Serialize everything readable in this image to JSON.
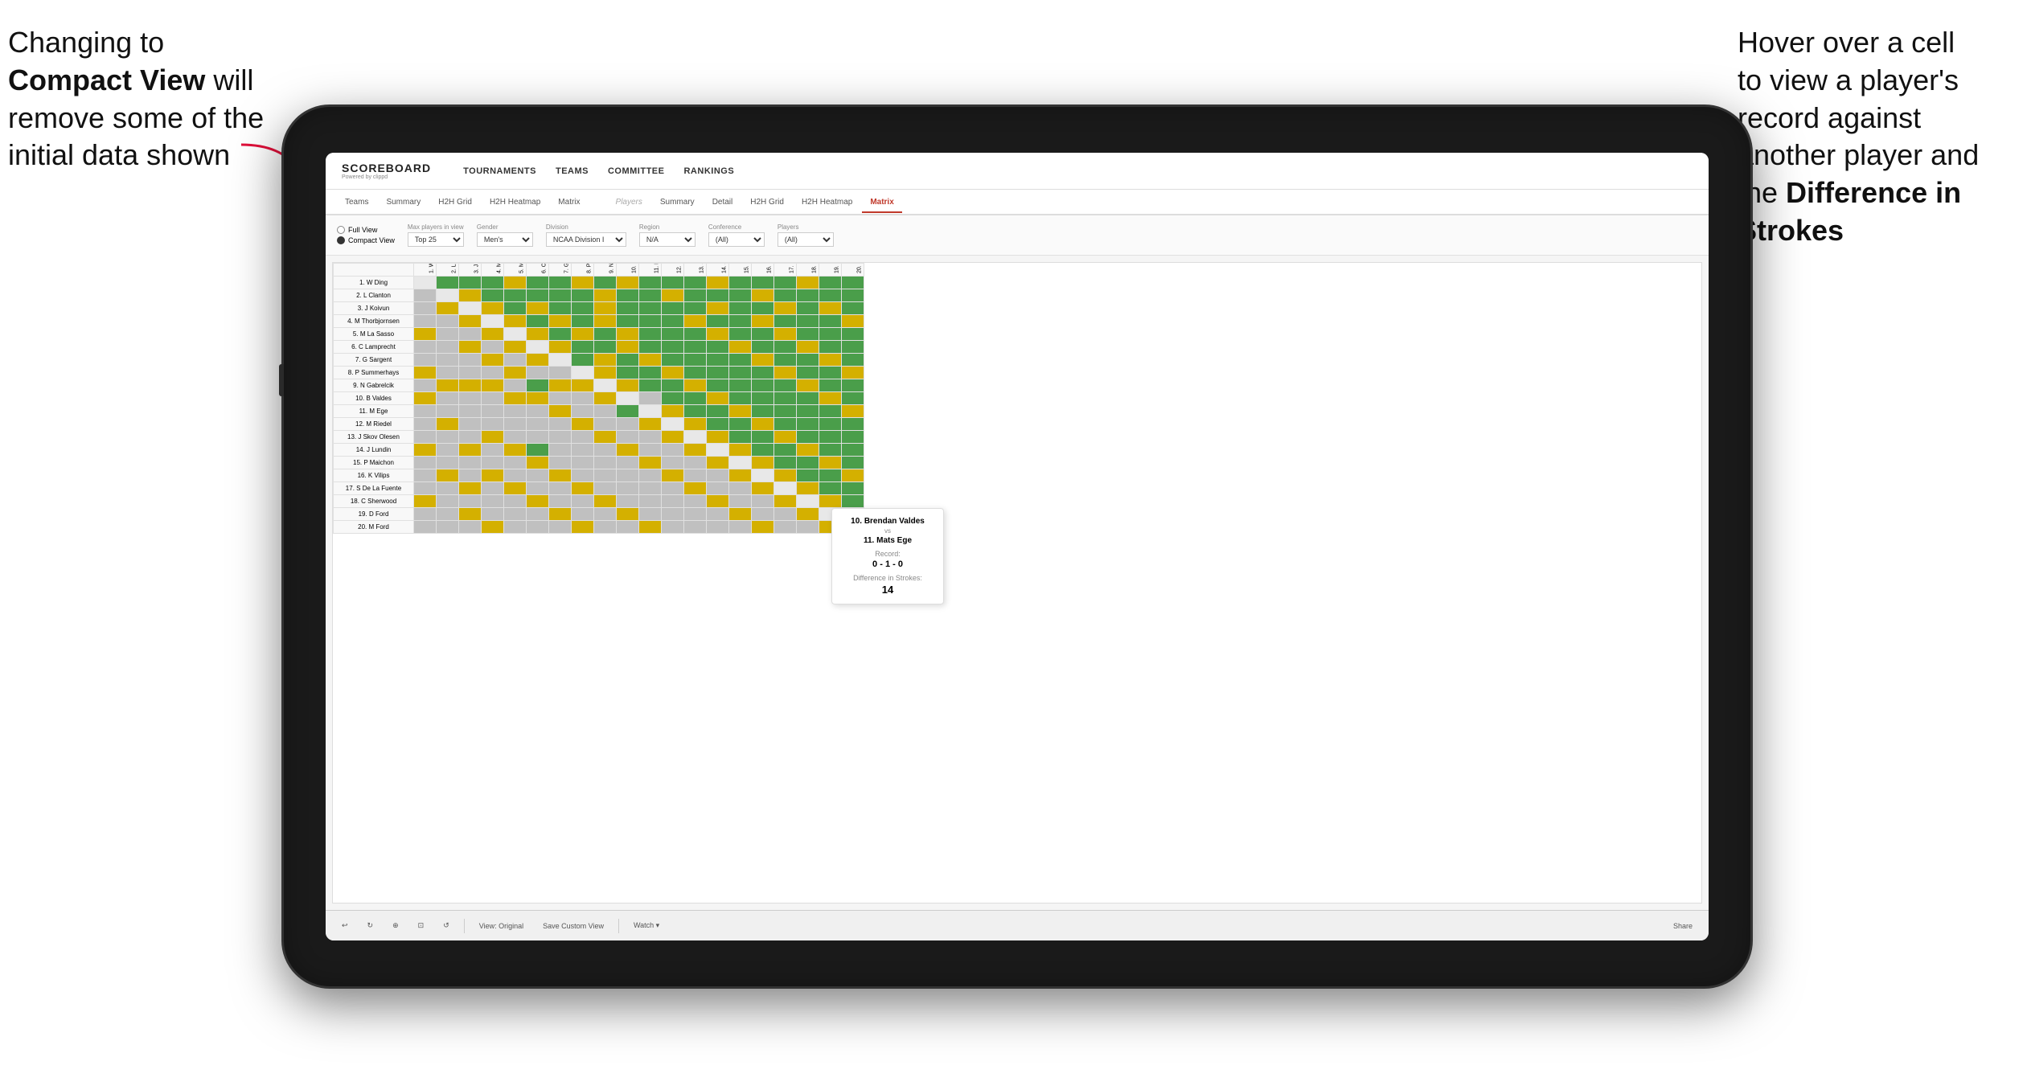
{
  "annotations": {
    "left_line1": "Changing to",
    "left_bold": "Compact View",
    "left_line2": " will",
    "left_line3": "remove some of the",
    "left_line4": "initial data shown",
    "right_line1": "Hover over a cell",
    "right_line2": "to view a player's",
    "right_line3": "record against",
    "right_line4": "another player and",
    "right_line5": "the ",
    "right_bold": "Difference in",
    "right_bold2": "Strokes"
  },
  "nav": {
    "logo": "SCOREBOARD",
    "logo_sub": "Powered by clippd",
    "items": [
      "TOURNAMENTS",
      "TEAMS",
      "COMMITTEE",
      "RANKINGS"
    ]
  },
  "subnav": {
    "left_items": [
      "Teams",
      "Summary",
      "H2H Grid",
      "H2H Heatmap",
      "Matrix"
    ],
    "section": "Players",
    "right_items": [
      "Summary",
      "Detail",
      "H2H Grid",
      "H2H Heatmap",
      "Matrix"
    ],
    "active": "Matrix"
  },
  "filters": {
    "view_options": [
      "Full View",
      "Compact View"
    ],
    "selected_view": "Compact View",
    "max_players_label": "Max players in view",
    "max_players_value": "Top 25",
    "gender_label": "Gender",
    "gender_value": "Men's",
    "division_label": "Division",
    "division_value": "NCAA Division I",
    "region_label": "Region",
    "region_value": "N/A",
    "conference_label": "Conference",
    "conference_value": "(All)",
    "players_label": "Players",
    "players_value": "(All)"
  },
  "players": [
    "1. W Ding",
    "2. L Clanton",
    "3. J Koivun",
    "4. M Thorbjornsen",
    "5. M La Sasso",
    "6. C Lamprecht",
    "7. G Sargent",
    "8. P Summerhays",
    "9. N Gabrelcik",
    "10. B Valdes",
    "11. M Ege",
    "12. M Riedel",
    "13. J Skov Olesen",
    "14. J Lundin",
    "15. P Maichon",
    "16. K Vilips",
    "17. S De La Fuente",
    "18. C Sherwood",
    "19. D Ford",
    "20. M Ford"
  ],
  "tooltip": {
    "player1": "10. Brendan Valdes",
    "vs": "vs",
    "player2": "11. Mats Ege",
    "record_label": "Record:",
    "record": "0 - 1 - 0",
    "diff_label": "Difference in Strokes:",
    "diff_value": "14"
  },
  "toolbar": {
    "undo": "↩",
    "redo": "↪",
    "view_original": "View: Original",
    "save_custom": "Save Custom View",
    "watch": "Watch ▾",
    "share": "Share"
  }
}
